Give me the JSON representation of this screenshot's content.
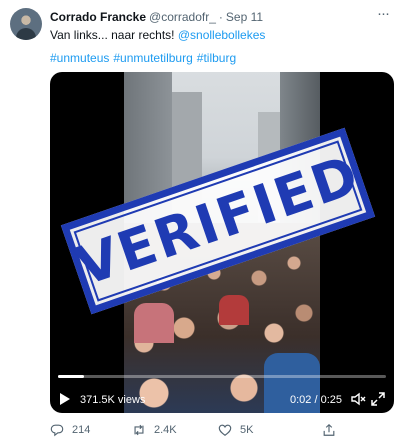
{
  "tweet": {
    "author": {
      "display_name": "Corrado Francke",
      "handle": "@corradofr_",
      "separator": "·",
      "date": "Sep 11"
    },
    "more_label": "···",
    "text": {
      "main": "Van links... naar rechts! ",
      "mention": "@snollebollekes"
    },
    "hashtags": [
      "#unmuteus",
      "#unmutetilburg",
      "#tilburg"
    ]
  },
  "video": {
    "overlay_stamp": "VERIFIED",
    "views": "371.5K views",
    "time": "0:02 / 0:25",
    "progress_fraction": 0.08
  },
  "actions": {
    "replies": "214",
    "retweets": "2.4K",
    "likes": "5K"
  },
  "icons": [
    "avatar",
    "more-icon",
    "play-icon",
    "mute-icon",
    "fullscreen-icon",
    "reply-icon",
    "retweet-icon",
    "like-icon",
    "share-icon"
  ],
  "colors": {
    "link": "#1d9bf0",
    "secondary_text": "#536471",
    "stamp": "#1f3bb3"
  }
}
